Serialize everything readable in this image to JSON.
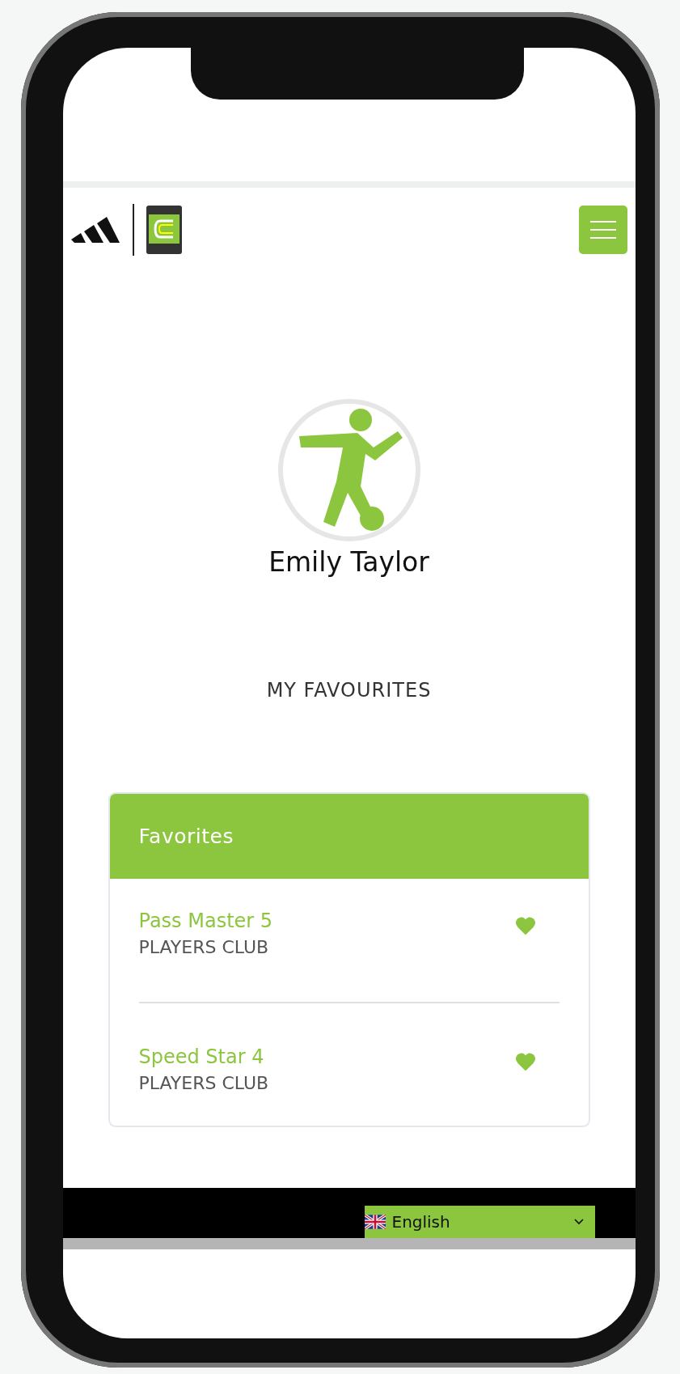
{
  "profile": {
    "name": "Emily Taylor"
  },
  "section_title": "MY FAVOURITES",
  "favorites": {
    "title": "Favorites",
    "items": [
      {
        "name": "Pass Master 5",
        "club": "PLAYERS CLUB",
        "favorited": true
      },
      {
        "name": "Speed Star 4",
        "club": "PLAYERS CLUB",
        "favorited": true
      }
    ]
  },
  "footer": {
    "language": "English"
  }
}
